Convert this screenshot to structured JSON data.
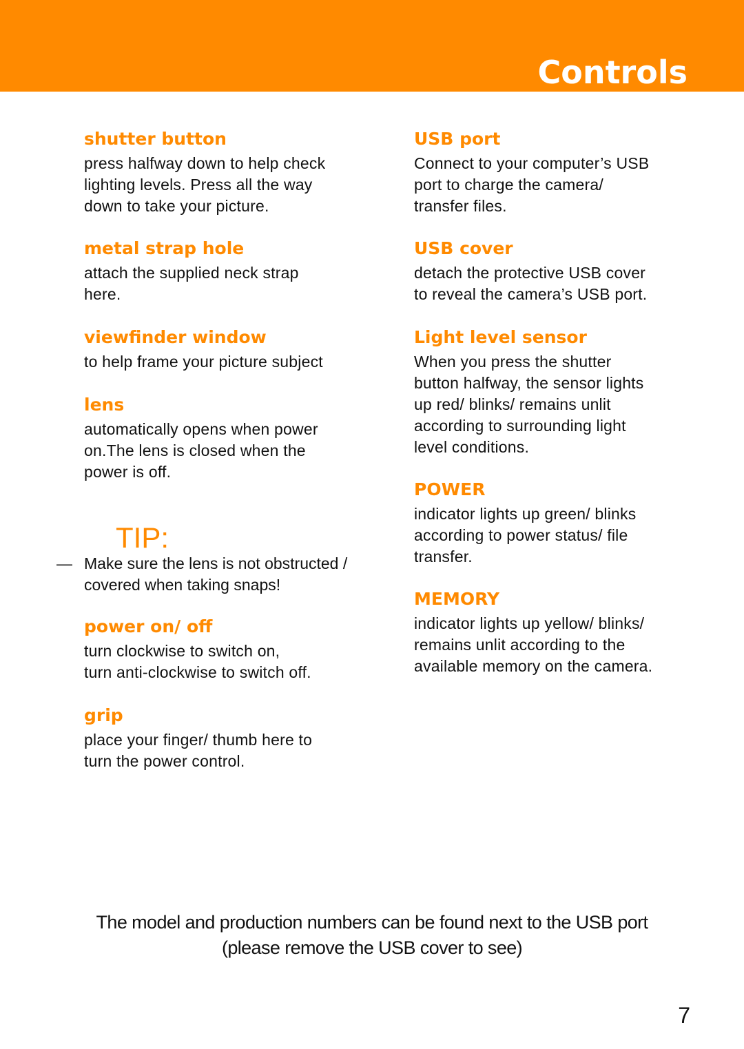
{
  "header": {
    "title": "Controls",
    "accent_color": "#ff8a00"
  },
  "left_column": [
    {
      "heading": "shutter button",
      "description": "press halfway down to help check\nlighting levels. Press all the way\ndown to take your picture."
    },
    {
      "heading": "metal strap hole",
      "description": "attach the supplied neck strap\nhere."
    },
    {
      "heading": "viewfinder window",
      "description": "to help frame your picture subject"
    },
    {
      "heading": "lens",
      "description": "automatically opens when power\non.The lens is closed when the\npower is off."
    },
    {
      "heading": "power on/ off",
      "description": "turn clockwise to switch on,\nturn anti-clockwise to switch off."
    },
    {
      "heading": "grip",
      "description": "place your finger/ thumb here to\nturn the power control."
    }
  ],
  "tip": {
    "label": "TIP:",
    "dash": "—",
    "text": "  Make sure the lens is not obstructed /\ncovered when taking snaps!"
  },
  "right_column": [
    {
      "heading": "USB port",
      "description": "Connect to your computer’s USB\nport to charge the camera/\ntransfer files."
    },
    {
      "heading": "USB cover",
      "description": "detach the protective USB cover\nto reveal the camera’s USB port."
    },
    {
      "heading": "Light level sensor",
      "description": "When you press the shutter\nbutton halfway, the sensor lights\nup red/ blinks/ remains unlit\naccording to surrounding light\nlevel conditions."
    },
    {
      "heading": "POWER",
      "description": "indicator lights up green/ blinks\naccording to power status/ file\ntransfer."
    },
    {
      "heading": "MEMORY",
      "description": "indicator lights up yellow/ blinks/\nremains unlit according to the\navailable memory on the camera."
    }
  ],
  "footer": {
    "line1": "The model and production numbers can be found next to the USB port",
    "line2": "(please remove the USB cover to see)"
  },
  "page_number": "7"
}
